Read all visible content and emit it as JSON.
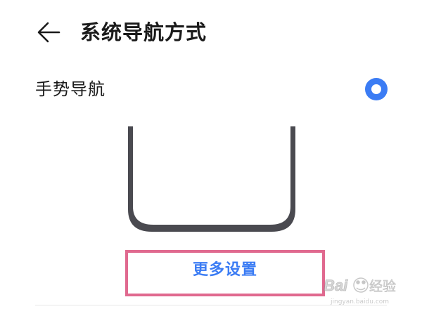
{
  "header": {
    "title": "系统导航方式",
    "back_icon": "arrow-left-icon"
  },
  "option": {
    "label": "手势导航",
    "selected": true
  },
  "more_settings": {
    "label": "更多设置"
  },
  "colors": {
    "accent": "#3b7cf4",
    "highlight_border": "#e0698f",
    "text": "#1a1a1a",
    "phone_outline": "#4a4a50"
  },
  "watermark": {
    "text": "Baidu经验",
    "sub": "jingyan.baidu.com"
  }
}
